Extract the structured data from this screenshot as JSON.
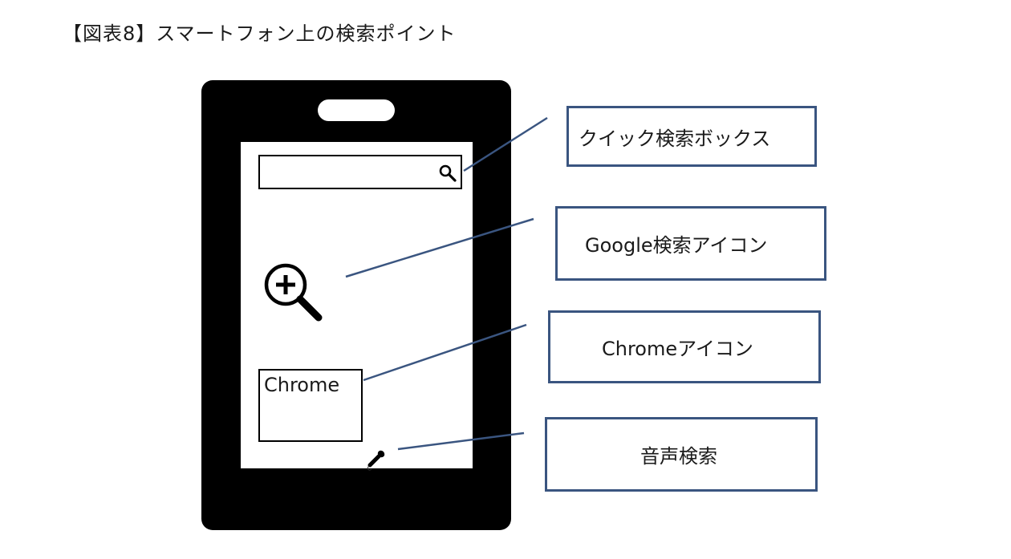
{
  "figure": {
    "title": "【図表8】スマートフォン上の検索ポイント"
  },
  "phone": {
    "chrome_icon_label": "Chrome",
    "icons": {
      "search": "magnifier-icon",
      "google_search": "magnifier-plus-icon",
      "voice": "microphone-icon"
    }
  },
  "callouts": [
    {
      "label": "クイック検索ボックス"
    },
    {
      "label": "Google検索アイコン"
    },
    {
      "label": "Chromeアイコン"
    },
    {
      "label": "音声検索"
    }
  ],
  "colors": {
    "callout_border": "#3a5580",
    "leader_line": "#3a5580",
    "phone_body": "#000000"
  }
}
